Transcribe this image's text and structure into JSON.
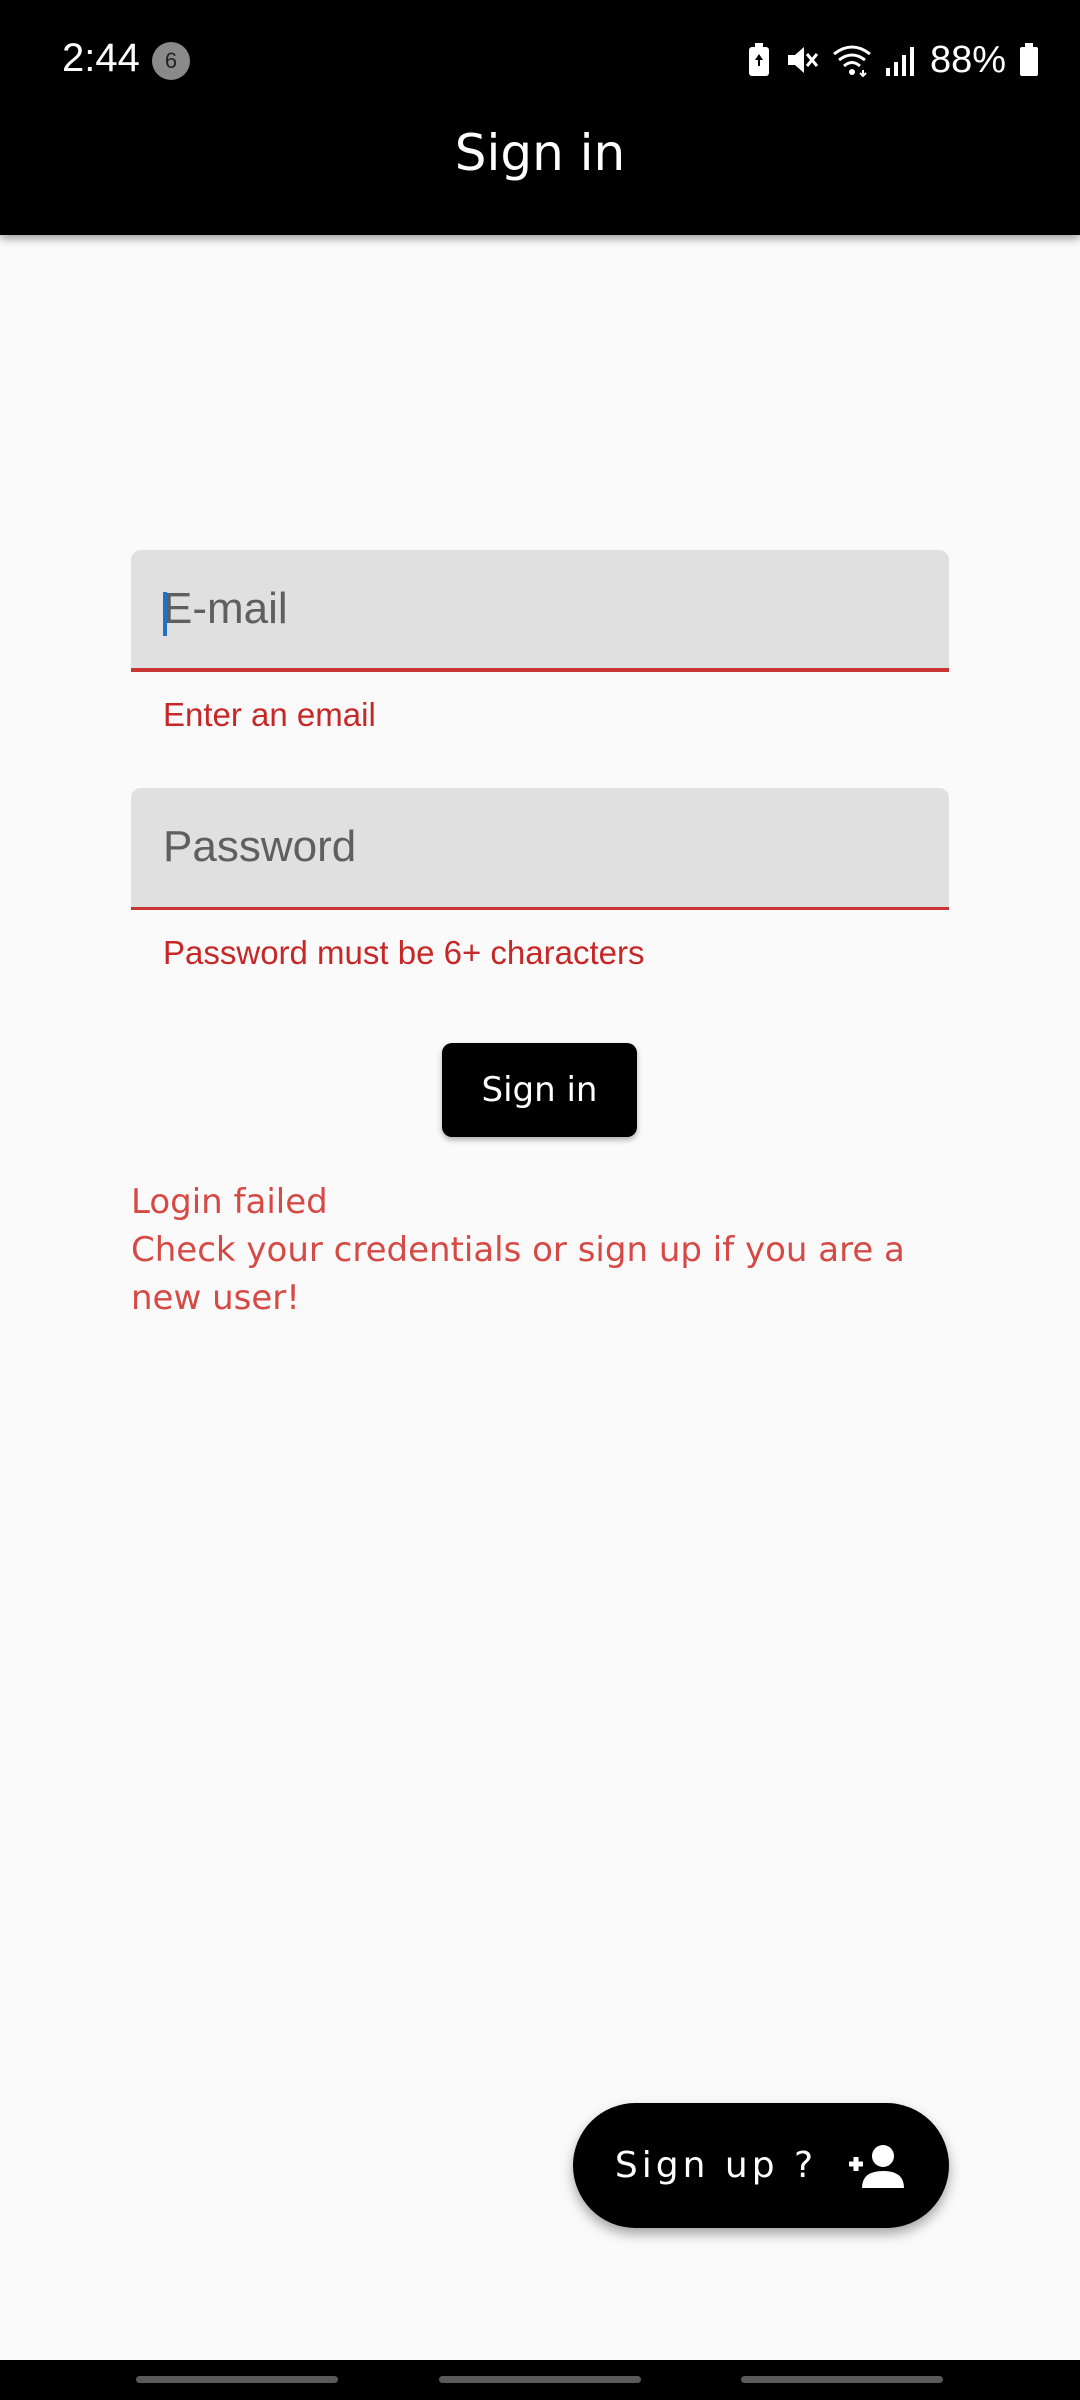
{
  "status_bar": {
    "time": "2:44",
    "notification_count": "6",
    "battery_percent": "88%",
    "icons": [
      "battery-saver-icon",
      "mute-icon",
      "wifi-icon",
      "signal-icon",
      "battery-icon"
    ]
  },
  "app_bar": {
    "title": "Sign in"
  },
  "form": {
    "email": {
      "placeholder": "E-mail",
      "value": "",
      "error": "Enter an email"
    },
    "password": {
      "placeholder": "Password",
      "value": "",
      "error": "Password must be 6+ characters"
    },
    "sign_in_label": "Sign in",
    "login_failed_line1": "Login failed",
    "login_failed_line2": "Check your credentials or sign up if you are a new user!"
  },
  "fab": {
    "label": "Sign up ?",
    "icon": "person-add-icon"
  },
  "colors": {
    "error": "#c62828",
    "app_bar": "#000000",
    "background": "#fafafa",
    "field_fill": "#e0e0e0",
    "caret": "#1e73c8"
  }
}
